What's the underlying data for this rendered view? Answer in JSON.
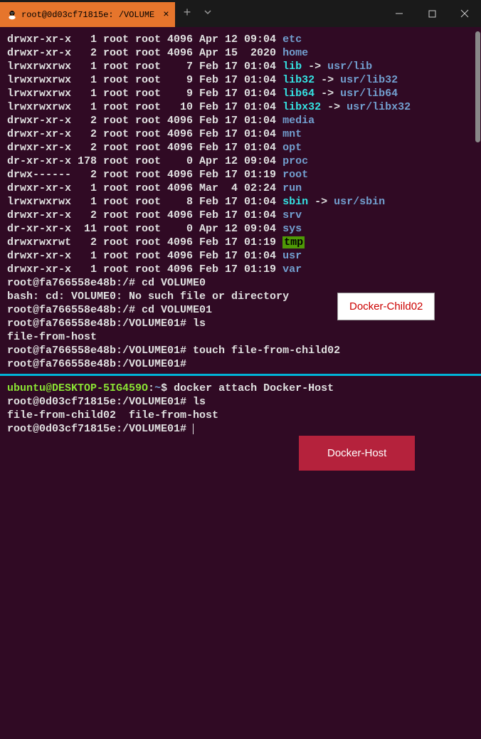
{
  "tab": {
    "title": "root@0d03cf71815e: /VOLUME"
  },
  "ls": [
    {
      "perm": "drwxr-xr-x",
      "links": "1",
      "owner": "root",
      "grp": "root",
      "size": "4096",
      "date": "Apr 12 09:04",
      "name": "etc",
      "cls": "c-blue"
    },
    {
      "perm": "drwxr-xr-x",
      "links": "2",
      "owner": "root",
      "grp": "root",
      "size": "4096",
      "date": "Apr 15  2020",
      "name": "home",
      "cls": "c-blue"
    },
    {
      "perm": "lrwxrwxrwx",
      "links": "1",
      "owner": "root",
      "grp": "root",
      "size": "7",
      "date": "Feb 17 01:04",
      "name": "lib",
      "cls": "c-cyan",
      "arrow": "->",
      "target": "usr/lib",
      "tcls": "c-blue"
    },
    {
      "perm": "lrwxrwxrwx",
      "links": "1",
      "owner": "root",
      "grp": "root",
      "size": "9",
      "date": "Feb 17 01:04",
      "name": "lib32",
      "cls": "c-cyan",
      "arrow": "->",
      "target": "usr/lib32",
      "tcls": "c-blue"
    },
    {
      "perm": "lrwxrwxrwx",
      "links": "1",
      "owner": "root",
      "grp": "root",
      "size": "9",
      "date": "Feb 17 01:04",
      "name": "lib64",
      "cls": "c-cyan",
      "arrow": "->",
      "target": "usr/lib64",
      "tcls": "c-blue"
    },
    {
      "perm": "lrwxrwxrwx",
      "links": "1",
      "owner": "root",
      "grp": "root",
      "size": "10",
      "date": "Feb 17 01:04",
      "name": "libx32",
      "cls": "c-cyan",
      "arrow": "->",
      "target": "usr/libx32",
      "tcls": "c-blue"
    },
    {
      "perm": "drwxr-xr-x",
      "links": "2",
      "owner": "root",
      "grp": "root",
      "size": "4096",
      "date": "Feb 17 01:04",
      "name": "media",
      "cls": "c-blue"
    },
    {
      "perm": "drwxr-xr-x",
      "links": "2",
      "owner": "root",
      "grp": "root",
      "size": "4096",
      "date": "Feb 17 01:04",
      "name": "mnt",
      "cls": "c-blue"
    },
    {
      "perm": "drwxr-xr-x",
      "links": "2",
      "owner": "root",
      "grp": "root",
      "size": "4096",
      "date": "Feb 17 01:04",
      "name": "opt",
      "cls": "c-blue"
    },
    {
      "perm": "dr-xr-xr-x",
      "links": "178",
      "owner": "root",
      "grp": "root",
      "size": "0",
      "date": "Apr 12 09:04",
      "name": "proc",
      "cls": "c-blue"
    },
    {
      "perm": "drwx------",
      "links": "2",
      "owner": "root",
      "grp": "root",
      "size": "4096",
      "date": "Feb 17 01:19",
      "name": "root",
      "cls": "c-blue"
    },
    {
      "perm": "drwxr-xr-x",
      "links": "1",
      "owner": "root",
      "grp": "root",
      "size": "4096",
      "date": "Mar  4 02:24",
      "name": "run",
      "cls": "c-blue"
    },
    {
      "perm": "lrwxrwxrwx",
      "links": "1",
      "owner": "root",
      "grp": "root",
      "size": "8",
      "date": "Feb 17 01:04",
      "name": "sbin",
      "cls": "c-cyan",
      "arrow": "->",
      "target": "usr/sbin",
      "tcls": "c-blue"
    },
    {
      "perm": "drwxr-xr-x",
      "links": "2",
      "owner": "root",
      "grp": "root",
      "size": "4096",
      "date": "Feb 17 01:04",
      "name": "srv",
      "cls": "c-blue"
    },
    {
      "perm": "dr-xr-xr-x",
      "links": "11",
      "owner": "root",
      "grp": "root",
      "size": "0",
      "date": "Apr 12 09:04",
      "name": "sys",
      "cls": "c-blue"
    },
    {
      "perm": "drwxrwxrwt",
      "links": "2",
      "owner": "root",
      "grp": "root",
      "size": "4096",
      "date": "Feb 17 01:19",
      "name": "tmp",
      "cls": "tmp-box"
    },
    {
      "perm": "drwxr-xr-x",
      "links": "1",
      "owner": "root",
      "grp": "root",
      "size": "4096",
      "date": "Feb 17 01:04",
      "name": "usr",
      "cls": "c-blue"
    },
    {
      "perm": "drwxr-xr-x",
      "links": "1",
      "owner": "root",
      "grp": "root",
      "size": "4096",
      "date": "Feb 17 01:19",
      "name": "var",
      "cls": "c-blue"
    }
  ],
  "session1": {
    "p1": "root@fa766558e48b:/#",
    "cmd1": "cd VOLUME0",
    "err": "bash: cd: VOLUME0: No such file or directory",
    "p2": "root@fa766558e48b:/#",
    "cmd2": "cd VOLUME01",
    "p3": "root@fa766558e48b:/VOLUME01#",
    "cmd3": "ls",
    "out3": "file-from-host",
    "p4": "root@fa766558e48b:/VOLUME01#",
    "cmd4": "touch file-from-child02",
    "p5": "root@fa766558e48b:/VOLUME01#"
  },
  "session2": {
    "user": "ubuntu@DESKTOP-5IG459O",
    "host_sep": ":",
    "path": "~",
    "dollar": "$",
    "cmd1": "docker attach Docker-Host",
    "p2": "root@0d03cf71815e:/VOLUME01#",
    "ls_cmd": "ls",
    "out": "file-from-child02  file-from-host",
    "p3": "root@0d03cf71815e:/VOLUME01#"
  },
  "labels": {
    "child": "Docker-Child02",
    "host": "Docker-Host"
  }
}
